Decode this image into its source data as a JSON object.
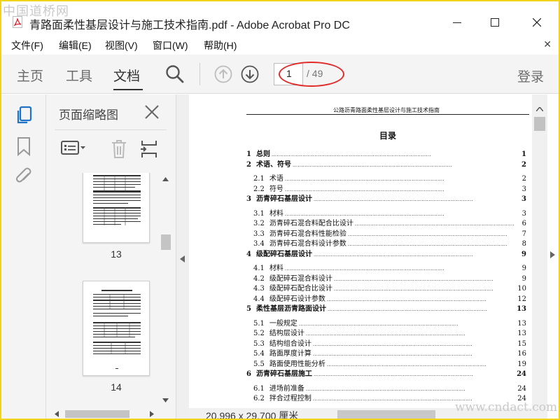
{
  "watermark": {
    "top": "中国道桥网",
    "bottom": "www.cndact.com"
  },
  "window": {
    "title": "青路面柔性基层设计与施工技术指南.pdf - Adobe Acrobat Pro DC"
  },
  "menu": {
    "items": [
      "文件(F)",
      "编辑(E)",
      "视图(V)",
      "窗口(W)",
      "帮助(H)"
    ]
  },
  "toolbar": {
    "tabs": [
      "主页",
      "工具",
      "文档"
    ],
    "active_tab": "文档",
    "page_current": "1",
    "page_total": "/ 49",
    "login": "登录"
  },
  "panel": {
    "title": "页面缩略图",
    "thumbnails": [
      {
        "label": "13"
      },
      {
        "label": "14"
      }
    ]
  },
  "document": {
    "header": "公路沥青路面柔性基层设计与施工技术指南",
    "heading": "目录",
    "toc": [
      {
        "level": 1,
        "num": "1",
        "title": "总则",
        "page": "1"
      },
      {
        "level": 1,
        "num": "2",
        "title": "术语、符号",
        "page": "2"
      },
      {
        "level": 2,
        "num": "2.1",
        "title": "术语",
        "page": "2"
      },
      {
        "level": 2,
        "num": "2.2",
        "title": "符号",
        "page": "3"
      },
      {
        "level": 1,
        "num": "3",
        "title": "沥青碎石基层设计",
        "page": "3"
      },
      {
        "level": 2,
        "num": "3.1",
        "title": "材料",
        "page": "3"
      },
      {
        "level": 2,
        "num": "3.2",
        "title": "沥青碎石混合料配合比设计",
        "page": "6"
      },
      {
        "level": 2,
        "num": "3.3",
        "title": "沥青碎石混合料性能检验",
        "page": "7"
      },
      {
        "level": 2,
        "num": "3.4",
        "title": "沥青碎石混合料设计参数",
        "page": "8"
      },
      {
        "level": 1,
        "num": "4",
        "title": "级配碎石基层设计",
        "page": "9"
      },
      {
        "level": 2,
        "num": "4.1",
        "title": "材料",
        "page": "9"
      },
      {
        "level": 2,
        "num": "4.2",
        "title": "级配碎石混合料设计",
        "page": "9"
      },
      {
        "level": 2,
        "num": "4.3",
        "title": "级配碎石配合比设计",
        "page": "10"
      },
      {
        "level": 2,
        "num": "4.4",
        "title": "级配碎石设计参数",
        "page": "12"
      },
      {
        "level": 1,
        "num": "5",
        "title": "柔性基层沥青路面设计",
        "page": "13"
      },
      {
        "level": 2,
        "num": "5.1",
        "title": "一般规定",
        "page": "13"
      },
      {
        "level": 2,
        "num": "5.2",
        "title": "结构层设计",
        "page": "13"
      },
      {
        "level": 2,
        "num": "5.3",
        "title": "结构组合设计",
        "page": "15"
      },
      {
        "level": 2,
        "num": "5.4",
        "title": "路面厚度计算",
        "page": "16"
      },
      {
        "level": 2,
        "num": "5.5",
        "title": "路面使用性能分析",
        "page": "19"
      },
      {
        "level": 1,
        "num": "6",
        "title": "沥青碎石基层施工",
        "page": "24"
      },
      {
        "level": 2,
        "num": "6.1",
        "title": "进场前准备",
        "page": "24"
      },
      {
        "level": 2,
        "num": "6.2",
        "title": "拌合过程控制",
        "page": "24"
      }
    ]
  },
  "status": {
    "page_size": "20.996 x 29.700 厘米"
  },
  "colors": {
    "annotation_ellipse": "#e12b2b",
    "frame_border": "#f2d21a"
  },
  "icons": [
    "pdf-file-icon",
    "search-icon",
    "arrow-up-icon",
    "arrow-down-icon",
    "page-thumbnails-icon",
    "bookmark-icon",
    "attachment-icon",
    "close-icon",
    "options-icon",
    "trash-icon",
    "insert-page-icon"
  ]
}
